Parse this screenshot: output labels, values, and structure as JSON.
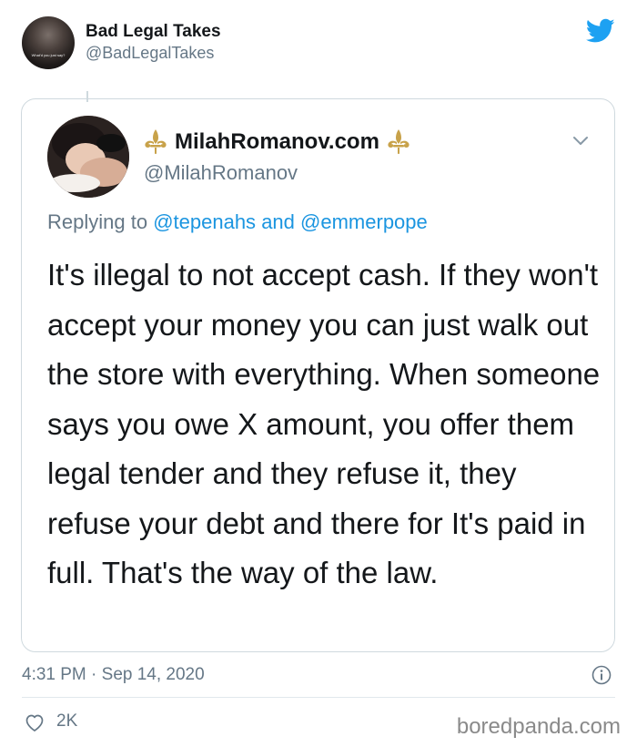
{
  "tweet": {
    "author": {
      "name": "Bad Legal Takes",
      "handle": "@BadLegalTakes",
      "avatar_caption": "What'd you just say?"
    },
    "brand_icon": "twitter-bird-icon",
    "quoted": {
      "name": "MilahRomanov.com",
      "handle": "@MilahRomanov",
      "name_decoration_icon": "fleur-de-lis-icon",
      "menu_icon": "chevron-down-icon",
      "reply_prefix": "Replying to",
      "reply_mention_1": "@tepenahs",
      "reply_and": "and",
      "reply_mention_2": "@emmerpope",
      "body": "It's illegal to not accept cash. If they won't accept your money you can just walk out the store with everything. When someone says you owe X amount, you offer them legal tender and they refuse it, they refuse your debt and there for It's paid in full. That's the way of the law."
    },
    "timestamp": "4:31 PM · Sep 14, 2020",
    "likes": "2K"
  },
  "watermark": "boredpanda.com",
  "colors": {
    "twitter_blue": "#1da1f2",
    "mention_blue": "#1b95e0",
    "secondary_text": "#657786",
    "fleur_gold": "#c8a24a"
  }
}
